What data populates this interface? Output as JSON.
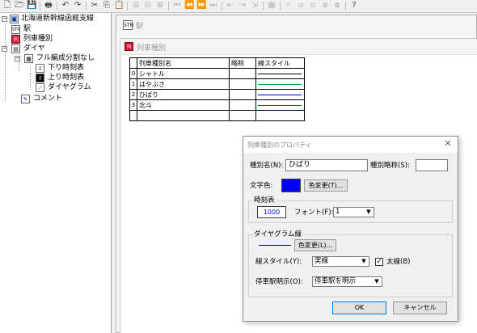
{
  "toolbar": {
    "icons": [
      "new-file-icon",
      "open-folder-icon",
      "save-icon",
      "print-icon",
      "undo-icon",
      "redo-icon",
      "cut-icon",
      "copy-icon",
      "paste-icon",
      "insert-row-icon",
      "insert-col-icon",
      "delete-row-icon",
      "first-icon",
      "prev-icon",
      "next-icon",
      "last-icon",
      "align-top-icon",
      "align-middle-icon",
      "align-bottom-icon",
      "grid-icon",
      "diagram-zoom-icon",
      "diagram-a-icon",
      "diagram-b-icon",
      "diagram-c-icon",
      "diagram-d-icon",
      "help-icon"
    ],
    "glyphs": [
      "🗋",
      "🗁",
      "💾",
      "🖶",
      "↶",
      "↷",
      "✂",
      "⎘",
      "📋",
      "⊞",
      "⊟",
      "⊠",
      "⏮",
      "⏪",
      "⏩",
      "⏭",
      "⇤",
      "⇥",
      "⇲",
      "▦",
      "⌗",
      "⧄",
      "⧅",
      "⧆",
      "⧇",
      "?"
    ]
  },
  "tree": {
    "root_label": "北海道新幹線函館支線",
    "station_label": "駅",
    "train_type_label": "列車種別",
    "diagram_label": "ダイヤ",
    "formation_label": "フル編成分割なし",
    "down_timetable_label": "下り時刻表",
    "up_timetable_label": "上り時刻表",
    "diagram_graph_label": "ダイヤグラム",
    "comment_label": "コメント",
    "station_icon_text": "STN",
    "collapse_glyph": "−"
  },
  "station_window": {
    "title": "駅",
    "icon_text": "STN"
  },
  "train_type_window": {
    "title": "列車種別",
    "icon_text": "列",
    "headers": {
      "name": "列車種別名",
      "abbr": "略称",
      "line_style": "線スタイル"
    },
    "rows": [
      {
        "index": "0",
        "name": "シャトル",
        "abbr": "",
        "line_color": "#000000"
      },
      {
        "index": "1",
        "name": "はやぶさ",
        "abbr": "",
        "line_color": "#00a040"
      },
      {
        "index": "2",
        "name": "ひばり",
        "abbr": "",
        "line_color": "#0000ff"
      },
      {
        "index": "3",
        "name": "北斗",
        "abbr": "",
        "line_color": "#e00000"
      }
    ]
  },
  "dialog": {
    "title": "列車種別のプロパティ",
    "close_glyph": "✕",
    "name_label": "種別名(N):",
    "name_value": "ひばり",
    "abbr_label": "種別略称(S):",
    "abbr_value": "",
    "text_color_label": "文字色:",
    "text_color_value": "#0000ff",
    "text_color_button": "色変更(T)...",
    "timetable_group": "時刻表",
    "timetable_sample": "1000",
    "font_label": "フォント(F):",
    "font_value": "1",
    "diagram_group": "ダイヤグラム線",
    "diagram_line_color": "#000080",
    "diagram_color_button": "色変更(L)...",
    "line_style_label": "線スタイル(Y):",
    "line_style_value": "実線",
    "bold_label": "太線(B)",
    "bold_checked": "✓",
    "stop_label": "停車駅明示(O):",
    "stop_value": "停車駅を明示",
    "ok_button": "OK",
    "cancel_button": "キャンセル",
    "dropdown_glyph": "▼"
  }
}
